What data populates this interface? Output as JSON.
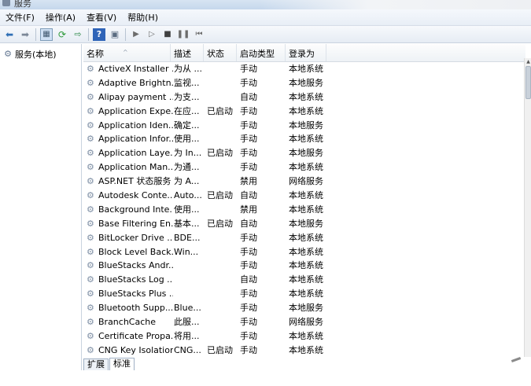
{
  "window": {
    "title": "服务"
  },
  "menu": [
    "文件(F)",
    "操作(A)",
    "查看(V)",
    "帮助(H)"
  ],
  "toolbar": {
    "back_icon": "back-arrow-icon",
    "forward_icon": "forward-arrow-icon",
    "console_tree_icon": "console-tree-icon",
    "refresh_icon": "refresh-icon",
    "export_icon": "export-list-icon",
    "help_icon": "help-icon",
    "properties_icon": "properties-icon",
    "start_icon": "play-icon",
    "start_alt_icon": "play-outline-icon",
    "stop_icon": "stop-icon",
    "pause_icon": "pause-icon",
    "restart_icon": "restart-icon"
  },
  "tree": {
    "root_label": "服务(本地)",
    "root_icon": "gear-icon"
  },
  "columns": [
    "名称",
    "描述",
    "状态",
    "启动类型",
    "登录为"
  ],
  "services": [
    {
      "name": "ActiveX Installer ...",
      "desc": "为从 ...",
      "status": "",
      "startup": "手动",
      "logon": "本地系统"
    },
    {
      "name": "Adaptive Brightn...",
      "desc": "监视...",
      "status": "",
      "startup": "手动",
      "logon": "本地服务"
    },
    {
      "name": "Alipay payment ...",
      "desc": "为支...",
      "status": "",
      "startup": "自动",
      "logon": "本地系统"
    },
    {
      "name": "Application Expe...",
      "desc": "在应...",
      "status": "已启动",
      "startup": "手动",
      "logon": "本地系统"
    },
    {
      "name": "Application Iden...",
      "desc": "确定...",
      "status": "",
      "startup": "手动",
      "logon": "本地服务"
    },
    {
      "name": "Application Infor...",
      "desc": "使用...",
      "status": "",
      "startup": "手动",
      "logon": "本地系统"
    },
    {
      "name": "Application Laye...",
      "desc": "为 In...",
      "status": "已启动",
      "startup": "手动",
      "logon": "本地服务"
    },
    {
      "name": "Application Man...",
      "desc": "为通...",
      "status": "",
      "startup": "手动",
      "logon": "本地系统"
    },
    {
      "name": "ASP.NET 状态服务",
      "desc": "为 A...",
      "status": "",
      "startup": "禁用",
      "logon": "网络服务"
    },
    {
      "name": "Autodesk Conte...",
      "desc": "Auto...",
      "status": "已启动",
      "startup": "自动",
      "logon": "本地系统"
    },
    {
      "name": "Background Inte...",
      "desc": "使用...",
      "status": "",
      "startup": "禁用",
      "logon": "本地系统"
    },
    {
      "name": "Base Filtering En...",
      "desc": "基本...",
      "status": "已启动",
      "startup": "自动",
      "logon": "本地服务"
    },
    {
      "name": "BitLocker Drive ...",
      "desc": "BDE...",
      "status": "",
      "startup": "手动",
      "logon": "本地系统"
    },
    {
      "name": "Block Level Back...",
      "desc": "Win...",
      "status": "",
      "startup": "手动",
      "logon": "本地系统"
    },
    {
      "name": "BlueStacks Andr...",
      "desc": "",
      "status": "",
      "startup": "手动",
      "logon": "本地系统"
    },
    {
      "name": "BlueStacks Log ...",
      "desc": "",
      "status": "",
      "startup": "自动",
      "logon": "本地系统"
    },
    {
      "name": "BlueStacks Plus ...",
      "desc": "",
      "status": "",
      "startup": "手动",
      "logon": "本地系统"
    },
    {
      "name": "Bluetooth Supp...",
      "desc": "Blue...",
      "status": "",
      "startup": "手动",
      "logon": "本地服务"
    },
    {
      "name": "BranchCache",
      "desc": "此服...",
      "status": "",
      "startup": "手动",
      "logon": "网络服务"
    },
    {
      "name": "Certificate Propa...",
      "desc": "将用...",
      "status": "",
      "startup": "手动",
      "logon": "本地系统"
    },
    {
      "name": "CNG Key Isolation",
      "desc": "CNG...",
      "status": "已启动",
      "startup": "手动",
      "logon": "本地系统"
    }
  ],
  "tabs": [
    "扩展",
    "标准"
  ],
  "active_tab": "标准"
}
